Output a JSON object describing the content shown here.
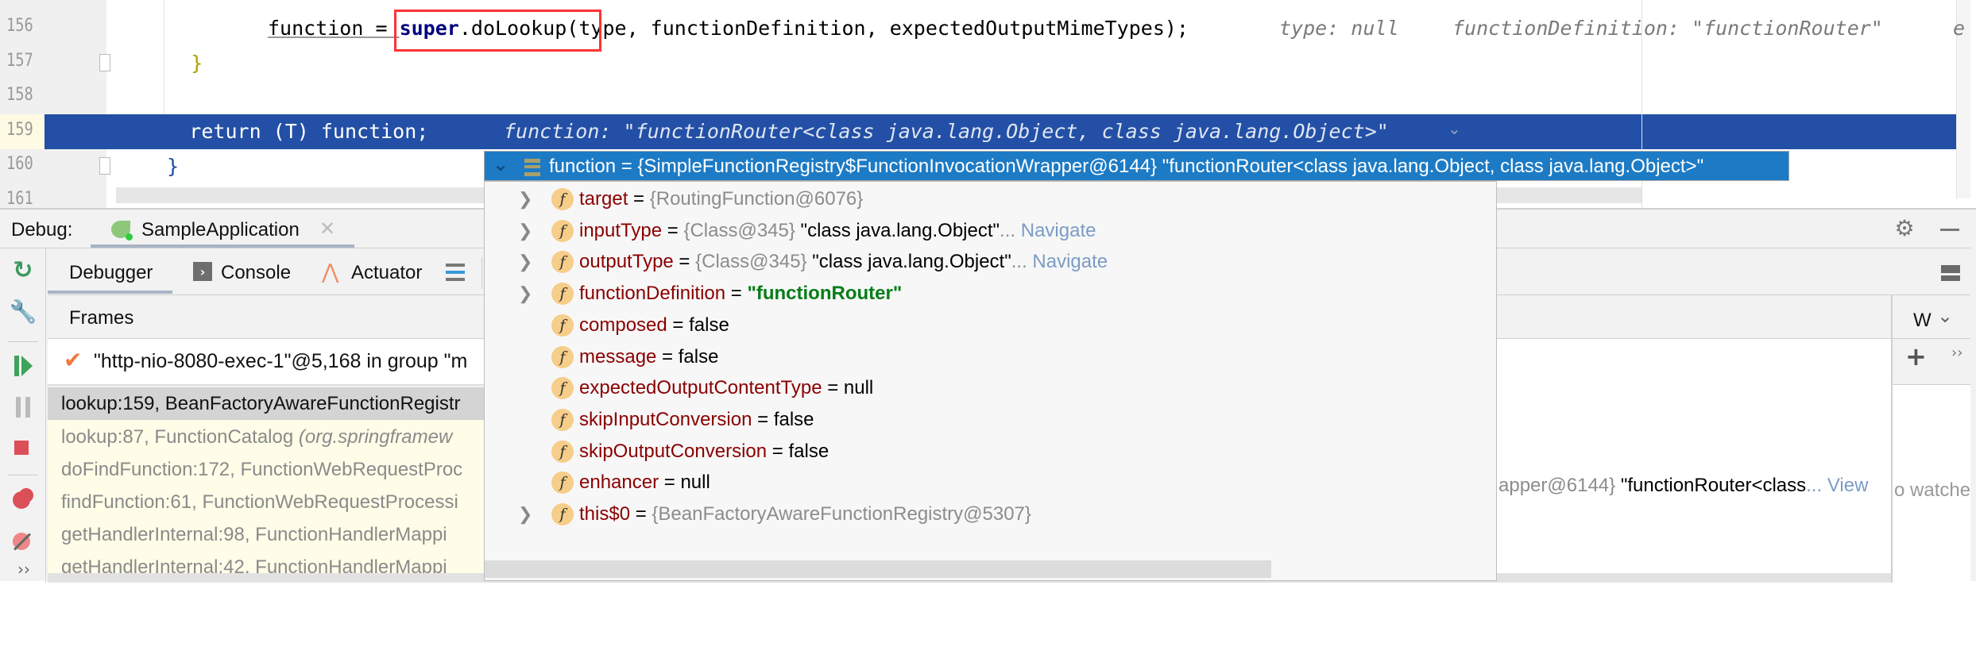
{
  "editor": {
    "lines": [
      {
        "num": "156",
        "indent": "        ",
        "pre": "function = ",
        "boxed_kw": "super",
        "boxed_rest": ".doLookup(",
        "post": "type, functionDefinition, expectedOutputMimeTypes);",
        "hints": [
          "type: null",
          "functionDefinition: \"functionRouter\"",
          "e"
        ]
      },
      {
        "num": "157",
        "code": "    }"
      },
      {
        "num": "158",
        "code": ""
      },
      {
        "num": "159",
        "code": "      return (T) function;",
        "hint": "function: \"functionRouter<class java.lang.Object, class java.lang.Object>\""
      },
      {
        "num": "160",
        "code": "  }"
      },
      {
        "num": "161",
        "code": ""
      }
    ],
    "highlight_color": "#2350a6",
    "annotation_box_color": "#ff3333"
  },
  "debug": {
    "label": "Debug:",
    "session_tab": "SampleApplication",
    "tabs": [
      {
        "label": "Debugger",
        "active": true
      },
      {
        "label": "Console"
      },
      {
        "label": "Actuator"
      }
    ],
    "frames_header": "Frames",
    "thread": "\"http-nio-8080-exec-1\"@5,168 in group \"m",
    "frames": [
      {
        "text": "lookup:159, BeanFactoryAwareFunctionRegistr",
        "selected": true
      },
      {
        "text": "lookup:87, FunctionCatalog ",
        "pkg": "(org.springframew"
      },
      {
        "text": "doFindFunction:172, FunctionWebRequestProc"
      },
      {
        "text": "findFunction:61, FunctionWebRequestProcessi"
      },
      {
        "text": "getHandlerInternal:98, FunctionHandlerMappi"
      },
      {
        "text": "getHandlerInternal:42, FunctionHandlerMappi"
      }
    ],
    "variables_row": {
      "value": "apper@6144}",
      "string": " \"functionRouter<class",
      "more": "... View"
    },
    "watches": {
      "header": "W",
      "empty": "o watche"
    }
  },
  "popup": {
    "header": "function = {SimpleFunctionRegistry$FunctionInvocationWrapper@6144} \"functionRouter<class java.lang.Object, class java.lang.Object>\"",
    "fields": [
      {
        "name": "target",
        "value": "{RoutingFunction@6076}",
        "kind": "ref",
        "expandable": true
      },
      {
        "name": "inputType",
        "value": "{Class@345}",
        "str": " \"class java.lang.Object\"",
        "link": "Navigate",
        "kind": "ref",
        "expandable": true
      },
      {
        "name": "outputType",
        "value": "{Class@345}",
        "str": " \"class java.lang.Object\"",
        "link": "Navigate",
        "kind": "ref",
        "expandable": true
      },
      {
        "name": "functionDefinition",
        "value": "\"functionRouter\"",
        "kind": "string",
        "expandable": true
      },
      {
        "name": "composed",
        "value": "false",
        "kind": "plain"
      },
      {
        "name": "message",
        "value": "false",
        "kind": "plain"
      },
      {
        "name": "expectedOutputContentType",
        "value": "null",
        "kind": "plain"
      },
      {
        "name": "skipInputConversion",
        "value": "false",
        "kind": "plain"
      },
      {
        "name": "skipOutputConversion",
        "value": "false",
        "kind": "plain"
      },
      {
        "name": "enhancer",
        "value": "null",
        "kind": "plain"
      },
      {
        "name": "this$0",
        "value": "{BeanFactoryAwareFunctionRegistry@5307}",
        "kind": "ref",
        "expandable": true
      }
    ],
    "ellipsis": "...",
    "field_icon": "f",
    "header_color": "#1d7bc5"
  }
}
